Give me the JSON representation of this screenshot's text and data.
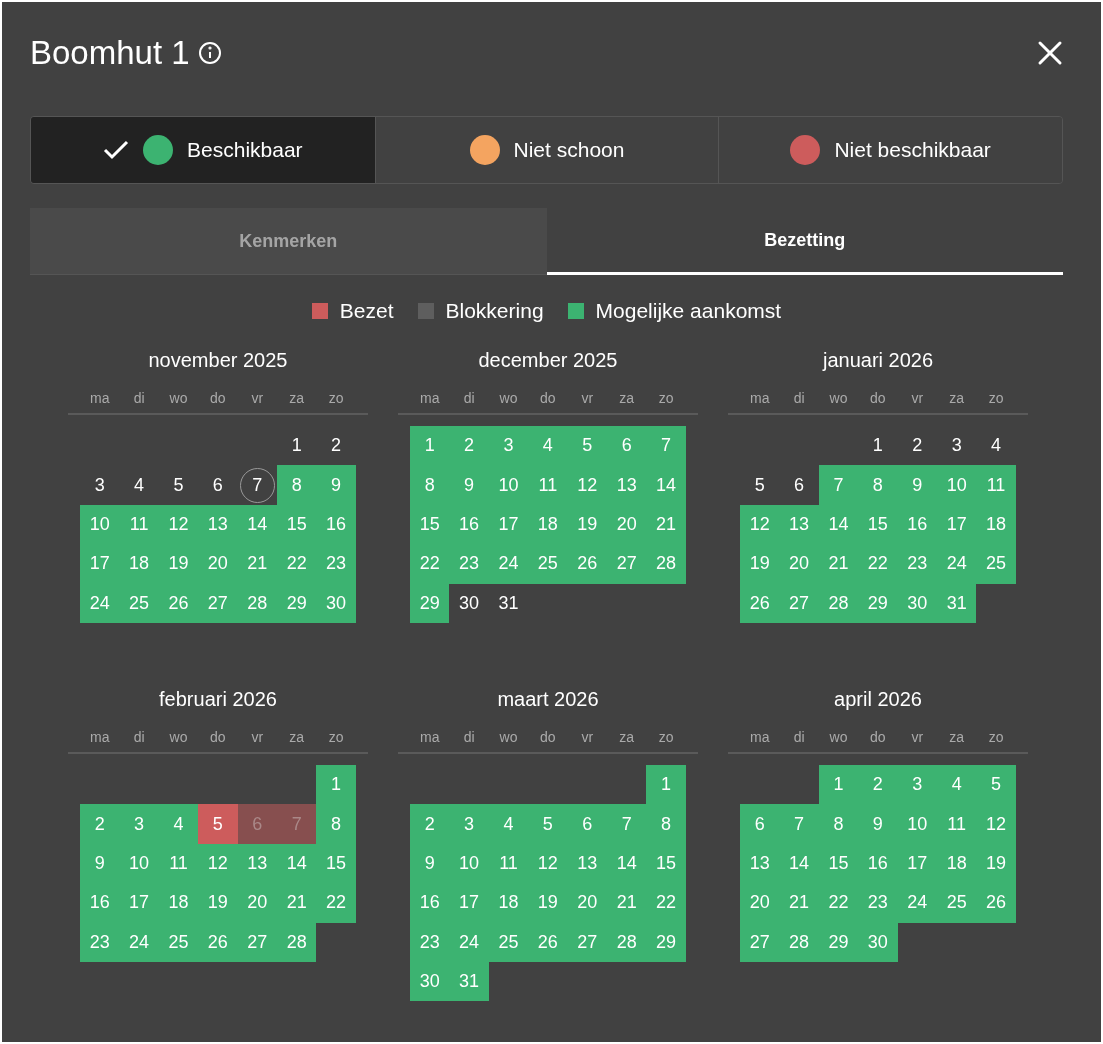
{
  "dialog": {
    "title": "Boomhut 1"
  },
  "statuses": [
    {
      "label": "Beschikbaar",
      "color": "#3cb371",
      "selected": true
    },
    {
      "label": "Niet schoon",
      "color": "#f4a460",
      "selected": false
    },
    {
      "label": "Niet beschikbaar",
      "color": "#cd5c5c",
      "selected": false
    }
  ],
  "tabs": [
    {
      "label": "Kenmerken",
      "selected": false
    },
    {
      "label": "Bezetting",
      "selected": true
    }
  ],
  "legend": [
    {
      "label": "Bezet",
      "color": "#cd5c5c"
    },
    {
      "label": "Blokkering",
      "color": "#5e5e5e"
    },
    {
      "label": "Mogelijke aankomst",
      "color": "#3cb371"
    }
  ],
  "months": [
    {
      "title": "november 2025",
      "weekdays": [
        "ma",
        "di",
        "wo",
        "do",
        "vr",
        "za",
        "zo"
      ],
      "weeks": [
        [
          {
            "d": "1",
            "kind": "free"
          },
          {
            "d": "2",
            "kind": "free"
          }
        ],
        [
          {
            "d": "3",
            "kind": "free"
          },
          {
            "d": "4",
            "kind": "free"
          },
          {
            "d": "5",
            "kind": "free"
          },
          {
            "d": "6",
            "kind": "free"
          },
          {
            "d": "7",
            "kind": "today"
          },
          {
            "d": "8",
            "kind": "arrival"
          },
          {
            "d": "9",
            "kind": "arrival"
          }
        ],
        [
          {
            "d": "10",
            "kind": "arrival"
          },
          {
            "d": "11",
            "kind": "arrival"
          },
          {
            "d": "12",
            "kind": "arrival"
          },
          {
            "d": "13",
            "kind": "arrival"
          },
          {
            "d": "14",
            "kind": "arrival"
          },
          {
            "d": "15",
            "kind": "arrival"
          },
          {
            "d": "16",
            "kind": "arrival"
          }
        ],
        [
          {
            "d": "17",
            "kind": "arrival"
          },
          {
            "d": "18",
            "kind": "arrival"
          },
          {
            "d": "19",
            "kind": "arrival"
          },
          {
            "d": "20",
            "kind": "arrival"
          },
          {
            "d": "21",
            "kind": "arrival"
          },
          {
            "d": "22",
            "kind": "arrival"
          },
          {
            "d": "23",
            "kind": "arrival"
          }
        ],
        [
          {
            "d": "24",
            "kind": "arrival"
          },
          {
            "d": "25",
            "kind": "arrival"
          },
          {
            "d": "26",
            "kind": "arrival"
          },
          {
            "d": "27",
            "kind": "arrival"
          },
          {
            "d": "28",
            "kind": "arrival"
          },
          {
            "d": "29",
            "kind": "arrival"
          },
          {
            "d": "30",
            "kind": "arrival"
          }
        ]
      ]
    },
    {
      "title": "december 2025",
      "weekdays": [
        "ma",
        "di",
        "wo",
        "do",
        "vr",
        "za",
        "zo"
      ],
      "weeks": [
        [
          {
            "d": "1",
            "kind": "arrival"
          },
          {
            "d": "2",
            "kind": "arrival"
          },
          {
            "d": "3",
            "kind": "arrival"
          },
          {
            "d": "4",
            "kind": "arrival"
          },
          {
            "d": "5",
            "kind": "arrival"
          },
          {
            "d": "6",
            "kind": "arrival"
          },
          {
            "d": "7",
            "kind": "arrival"
          }
        ],
        [
          {
            "d": "8",
            "kind": "arrival"
          },
          {
            "d": "9",
            "kind": "arrival"
          },
          {
            "d": "10",
            "kind": "arrival"
          },
          {
            "d": "11",
            "kind": "arrival"
          },
          {
            "d": "12",
            "kind": "arrival"
          },
          {
            "d": "13",
            "kind": "arrival"
          },
          {
            "d": "14",
            "kind": "arrival"
          }
        ],
        [
          {
            "d": "15",
            "kind": "arrival"
          },
          {
            "d": "16",
            "kind": "arrival"
          },
          {
            "d": "17",
            "kind": "arrival"
          },
          {
            "d": "18",
            "kind": "arrival"
          },
          {
            "d": "19",
            "kind": "arrival"
          },
          {
            "d": "20",
            "kind": "arrival"
          },
          {
            "d": "21",
            "kind": "arrival"
          }
        ],
        [
          {
            "d": "22",
            "kind": "arrival"
          },
          {
            "d": "23",
            "kind": "arrival"
          },
          {
            "d": "24",
            "kind": "arrival"
          },
          {
            "d": "25",
            "kind": "arrival"
          },
          {
            "d": "26",
            "kind": "arrival"
          },
          {
            "d": "27",
            "kind": "arrival"
          },
          {
            "d": "28",
            "kind": "arrival"
          }
        ],
        [
          {
            "d": "29",
            "kind": "arrival"
          },
          {
            "d": "30",
            "kind": "free"
          },
          {
            "d": "31",
            "kind": "free"
          }
        ]
      ]
    },
    {
      "title": "januari 2026",
      "weekdays": [
        "ma",
        "di",
        "wo",
        "do",
        "vr",
        "za",
        "zo"
      ],
      "weeks": [
        [
          {
            "d": "1",
            "kind": "free"
          },
          {
            "d": "2",
            "kind": "free"
          },
          {
            "d": "3",
            "kind": "free"
          },
          {
            "d": "4",
            "kind": "free"
          }
        ],
        [
          {
            "d": "5",
            "kind": "free"
          },
          {
            "d": "6",
            "kind": "free"
          },
          {
            "d": "7",
            "kind": "arrival"
          },
          {
            "d": "8",
            "kind": "arrival"
          },
          {
            "d": "9",
            "kind": "arrival"
          },
          {
            "d": "10",
            "kind": "arrival"
          },
          {
            "d": "11",
            "kind": "arrival"
          }
        ],
        [
          {
            "d": "12",
            "kind": "arrival"
          },
          {
            "d": "13",
            "kind": "arrival"
          },
          {
            "d": "14",
            "kind": "arrival"
          },
          {
            "d": "15",
            "kind": "arrival"
          },
          {
            "d": "16",
            "kind": "arrival"
          },
          {
            "d": "17",
            "kind": "arrival"
          },
          {
            "d": "18",
            "kind": "arrival"
          }
        ],
        [
          {
            "d": "19",
            "kind": "arrival"
          },
          {
            "d": "20",
            "kind": "arrival"
          },
          {
            "d": "21",
            "kind": "arrival"
          },
          {
            "d": "22",
            "kind": "arrival"
          },
          {
            "d": "23",
            "kind": "arrival"
          },
          {
            "d": "24",
            "kind": "arrival"
          },
          {
            "d": "25",
            "kind": "arrival"
          }
        ],
        [
          {
            "d": "26",
            "kind": "arrival"
          },
          {
            "d": "27",
            "kind": "arrival"
          },
          {
            "d": "28",
            "kind": "arrival"
          },
          {
            "d": "29",
            "kind": "arrival"
          },
          {
            "d": "30",
            "kind": "arrival"
          },
          {
            "d": "31",
            "kind": "arrival"
          }
        ]
      ]
    },
    {
      "title": "februari 2026",
      "weekdays": [
        "ma",
        "di",
        "wo",
        "do",
        "vr",
        "za",
        "zo"
      ],
      "weeks": [
        [
          {
            "d": "1",
            "kind": "arrival"
          }
        ],
        [
          {
            "d": "2",
            "kind": "arrival"
          },
          {
            "d": "3",
            "kind": "arrival"
          },
          {
            "d": "4",
            "kind": "arrival"
          },
          {
            "d": "5",
            "kind": "occupied"
          },
          {
            "d": "6",
            "kind": "blocked"
          },
          {
            "d": "7",
            "kind": "blocked"
          },
          {
            "d": "8",
            "kind": "arrival"
          }
        ],
        [
          {
            "d": "9",
            "kind": "arrival"
          },
          {
            "d": "10",
            "kind": "arrival"
          },
          {
            "d": "11",
            "kind": "arrival"
          },
          {
            "d": "12",
            "kind": "arrival"
          },
          {
            "d": "13",
            "kind": "arrival"
          },
          {
            "d": "14",
            "kind": "arrival"
          },
          {
            "d": "15",
            "kind": "arrival"
          }
        ],
        [
          {
            "d": "16",
            "kind": "arrival"
          },
          {
            "d": "17",
            "kind": "arrival"
          },
          {
            "d": "18",
            "kind": "arrival"
          },
          {
            "d": "19",
            "kind": "arrival"
          },
          {
            "d": "20",
            "kind": "arrival"
          },
          {
            "d": "21",
            "kind": "arrival"
          },
          {
            "d": "22",
            "kind": "arrival"
          }
        ],
        [
          {
            "d": "23",
            "kind": "arrival"
          },
          {
            "d": "24",
            "kind": "arrival"
          },
          {
            "d": "25",
            "kind": "arrival"
          },
          {
            "d": "26",
            "kind": "arrival"
          },
          {
            "d": "27",
            "kind": "arrival"
          },
          {
            "d": "28",
            "kind": "arrival"
          }
        ]
      ]
    },
    {
      "title": "maart 2026",
      "weekdays": [
        "ma",
        "di",
        "wo",
        "do",
        "vr",
        "za",
        "zo"
      ],
      "weeks": [
        [
          {
            "d": "1",
            "kind": "arrival"
          }
        ],
        [
          {
            "d": "2",
            "kind": "arrival"
          },
          {
            "d": "3",
            "kind": "arrival"
          },
          {
            "d": "4",
            "kind": "arrival"
          },
          {
            "d": "5",
            "kind": "arrival"
          },
          {
            "d": "6",
            "kind": "arrival"
          },
          {
            "d": "7",
            "kind": "arrival"
          },
          {
            "d": "8",
            "kind": "arrival"
          }
        ],
        [
          {
            "d": "9",
            "kind": "arrival"
          },
          {
            "d": "10",
            "kind": "arrival"
          },
          {
            "d": "11",
            "kind": "arrival"
          },
          {
            "d": "12",
            "kind": "arrival"
          },
          {
            "d": "13",
            "kind": "arrival"
          },
          {
            "d": "14",
            "kind": "arrival"
          },
          {
            "d": "15",
            "kind": "arrival"
          }
        ],
        [
          {
            "d": "16",
            "kind": "arrival"
          },
          {
            "d": "17",
            "kind": "arrival"
          },
          {
            "d": "18",
            "kind": "arrival"
          },
          {
            "d": "19",
            "kind": "arrival"
          },
          {
            "d": "20",
            "kind": "arrival"
          },
          {
            "d": "21",
            "kind": "arrival"
          },
          {
            "d": "22",
            "kind": "arrival"
          }
        ],
        [
          {
            "d": "23",
            "kind": "arrival"
          },
          {
            "d": "24",
            "kind": "arrival"
          },
          {
            "d": "25",
            "kind": "arrival"
          },
          {
            "d": "26",
            "kind": "arrival"
          },
          {
            "d": "27",
            "kind": "arrival"
          },
          {
            "d": "28",
            "kind": "arrival"
          },
          {
            "d": "29",
            "kind": "arrival"
          }
        ],
        [
          {
            "d": "30",
            "kind": "arrival"
          },
          {
            "d": "31",
            "kind": "arrival"
          }
        ]
      ]
    },
    {
      "title": "april 2026",
      "weekdays": [
        "ma",
        "di",
        "wo",
        "do",
        "vr",
        "za",
        "zo"
      ],
      "weeks": [
        [
          {
            "d": "1",
            "kind": "arrival"
          },
          {
            "d": "2",
            "kind": "arrival"
          },
          {
            "d": "3",
            "kind": "arrival"
          },
          {
            "d": "4",
            "kind": "arrival"
          },
          {
            "d": "5",
            "kind": "arrival"
          }
        ],
        [
          {
            "d": "6",
            "kind": "arrival"
          },
          {
            "d": "7",
            "kind": "arrival"
          },
          {
            "d": "8",
            "kind": "arrival"
          },
          {
            "d": "9",
            "kind": "arrival"
          },
          {
            "d": "10",
            "kind": "arrival"
          },
          {
            "d": "11",
            "kind": "arrival"
          },
          {
            "d": "12",
            "kind": "arrival"
          }
        ],
        [
          {
            "d": "13",
            "kind": "arrival"
          },
          {
            "d": "14",
            "kind": "arrival"
          },
          {
            "d": "15",
            "kind": "arrival"
          },
          {
            "d": "16",
            "kind": "arrival"
          },
          {
            "d": "17",
            "kind": "arrival"
          },
          {
            "d": "18",
            "kind": "arrival"
          },
          {
            "d": "19",
            "kind": "arrival"
          }
        ],
        [
          {
            "d": "20",
            "kind": "arrival"
          },
          {
            "d": "21",
            "kind": "arrival"
          },
          {
            "d": "22",
            "kind": "arrival"
          },
          {
            "d": "23",
            "kind": "arrival"
          },
          {
            "d": "24",
            "kind": "arrival"
          },
          {
            "d": "25",
            "kind": "arrival"
          },
          {
            "d": "26",
            "kind": "arrival"
          }
        ],
        [
          {
            "d": "27",
            "kind": "arrival"
          },
          {
            "d": "28",
            "kind": "arrival"
          },
          {
            "d": "29",
            "kind": "arrival"
          },
          {
            "d": "30",
            "kind": "arrival"
          }
        ]
      ]
    }
  ]
}
